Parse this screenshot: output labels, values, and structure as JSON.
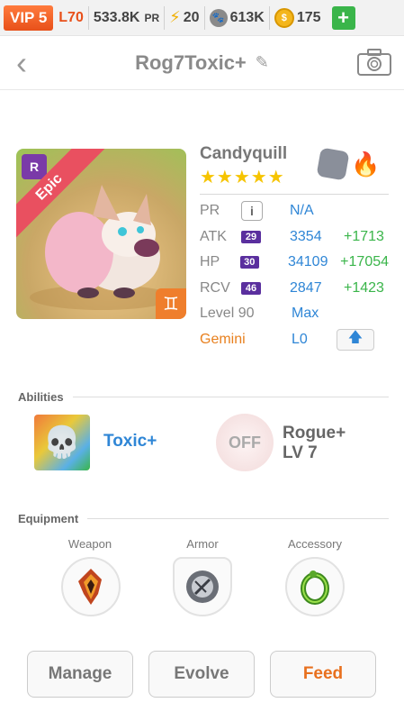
{
  "topbar": {
    "vip": "VIP 5",
    "level": "L70",
    "power": "533.8K",
    "power_unit": "PR",
    "energy": "20",
    "paws": "613K",
    "coins": "175",
    "plus": "+"
  },
  "header": {
    "back": "‹",
    "title": "Rog7Toxic+",
    "edit_icon": "✎"
  },
  "card": {
    "rarity": "Epic",
    "rank_badge": "R",
    "zodiac_symbol": "♊"
  },
  "pet": {
    "name": "Candyquill",
    "stars": "★★★★★",
    "star_count": 5,
    "stats": [
      {
        "label": "PR",
        "value": "N/A",
        "info": "i"
      },
      {
        "label": "ATK",
        "level": "29",
        "value": "3354",
        "bonus": "+1713"
      },
      {
        "label": "HP",
        "level": "30",
        "value": "34109",
        "bonus": "+17054"
      },
      {
        "label": "RCV",
        "level": "46",
        "value": "2847",
        "bonus": "+1423"
      },
      {
        "label": "Level 90",
        "value": "Max"
      },
      {
        "label": "Gemini",
        "value": "L0",
        "upgrade": "🡅"
      }
    ]
  },
  "abilities": {
    "heading": "Abilities",
    "active": {
      "name": "Toxic+"
    },
    "passive": {
      "status": "OFF",
      "name": "Rogue+",
      "level": "LV 7"
    }
  },
  "equipment": {
    "heading": "Equipment",
    "slots": [
      {
        "label": "Weapon"
      },
      {
        "label": "Armor"
      },
      {
        "label": "Accessory"
      }
    ]
  },
  "buttons": {
    "manage": "Manage",
    "evolve": "Evolve",
    "feed": "Feed"
  },
  "colors": {
    "accent_orange": "#e8501a",
    "link_blue": "#2f86d6",
    "bonus_green": "#3ab54a",
    "epic_red": "#e95060"
  }
}
